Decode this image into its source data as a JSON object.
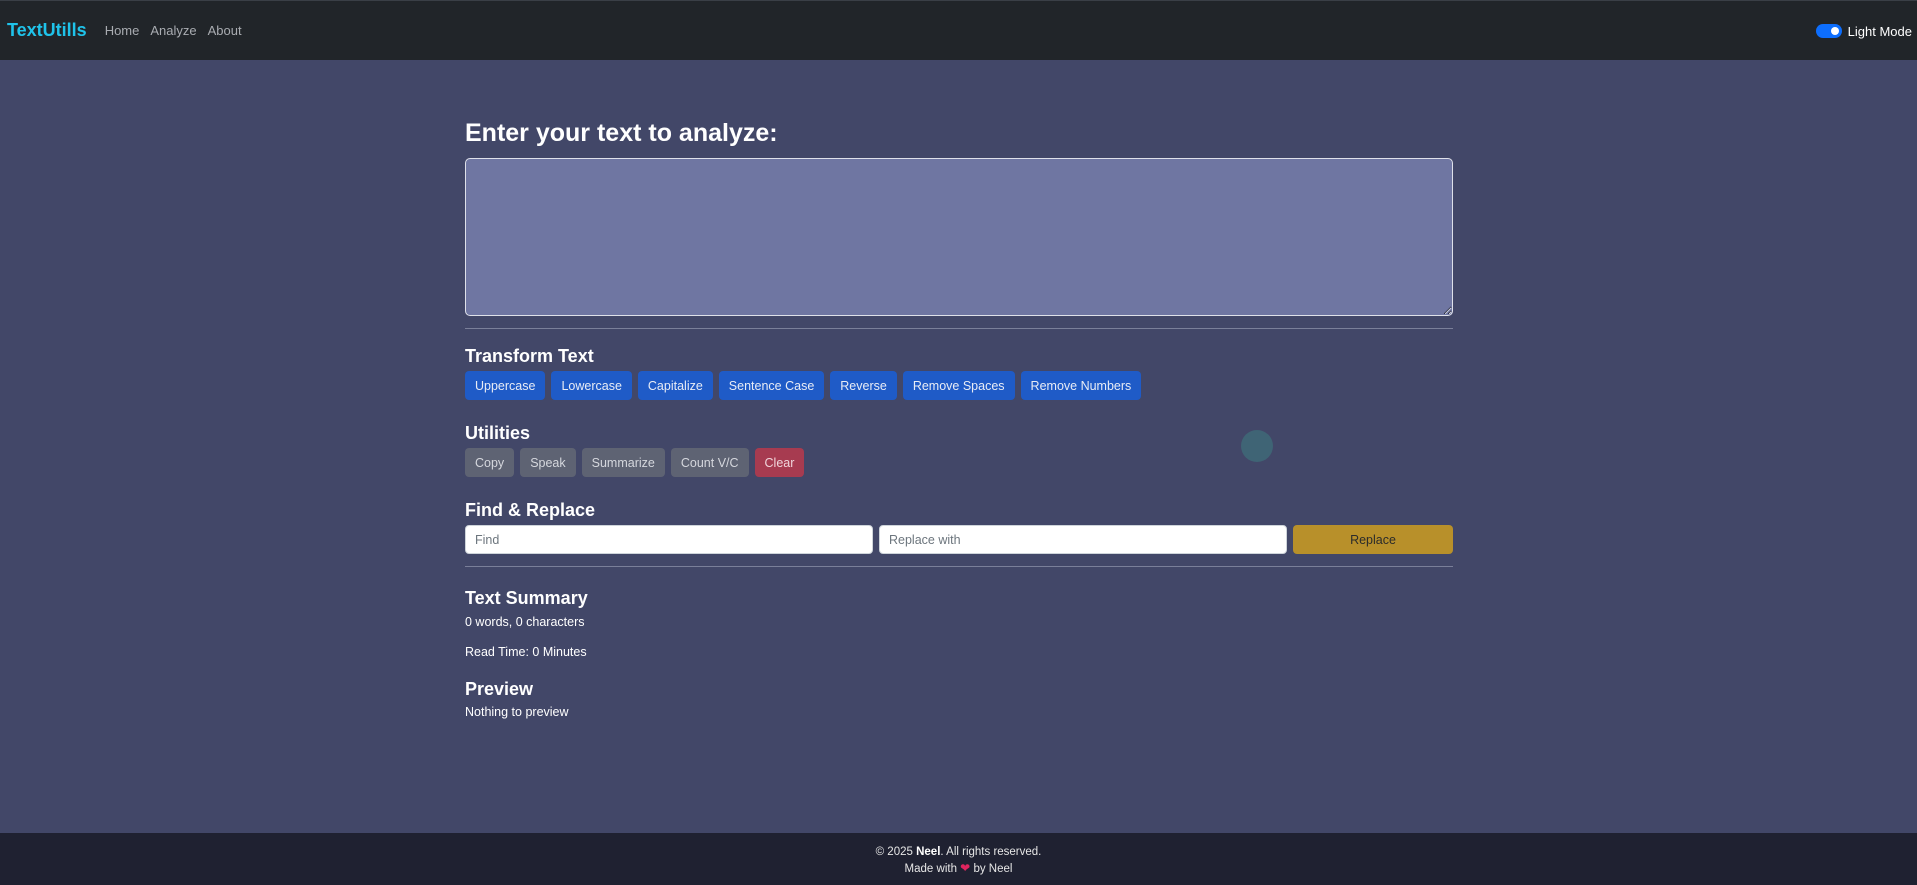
{
  "navbar": {
    "brand": "TextUtills",
    "links": [
      "Home",
      "Analyze",
      "About"
    ],
    "mode_label": "Light Mode"
  },
  "main": {
    "title": "Enter your text to analyze:",
    "textarea_value": ""
  },
  "transform": {
    "heading": "Transform Text",
    "buttons": [
      "Uppercase",
      "Lowercase",
      "Capitalize",
      "Sentence Case",
      "Reverse",
      "Remove Spaces",
      "Remove Numbers"
    ]
  },
  "utilities": {
    "heading": "Utilities",
    "buttons": [
      "Copy",
      "Speak",
      "Summarize",
      "Count V/C",
      "Clear"
    ]
  },
  "find_replace": {
    "heading": "Find & Replace",
    "find_placeholder": "Find",
    "replace_placeholder": "Replace with",
    "button_label": "Replace"
  },
  "summary": {
    "heading": "Text Summary",
    "counts": "0 words, 0 characters",
    "read_time": "Read Time: 0 Minutes"
  },
  "preview": {
    "heading": "Preview",
    "text": "Nothing to preview"
  },
  "footer": {
    "copyright_prefix": "© 2025",
    "author": "Neel",
    "copyright_suffix": ". All rights reserved.",
    "made_with": "Made with",
    "heart": "❤",
    "by": "by Neel"
  },
  "colors": {
    "background": "#424768",
    "navbar": "#212529",
    "brand": "#1fc3ea",
    "primary": "#1f5bc7",
    "secondary": "#5e6373",
    "danger": "#a73b50",
    "warning": "#b8902a"
  }
}
